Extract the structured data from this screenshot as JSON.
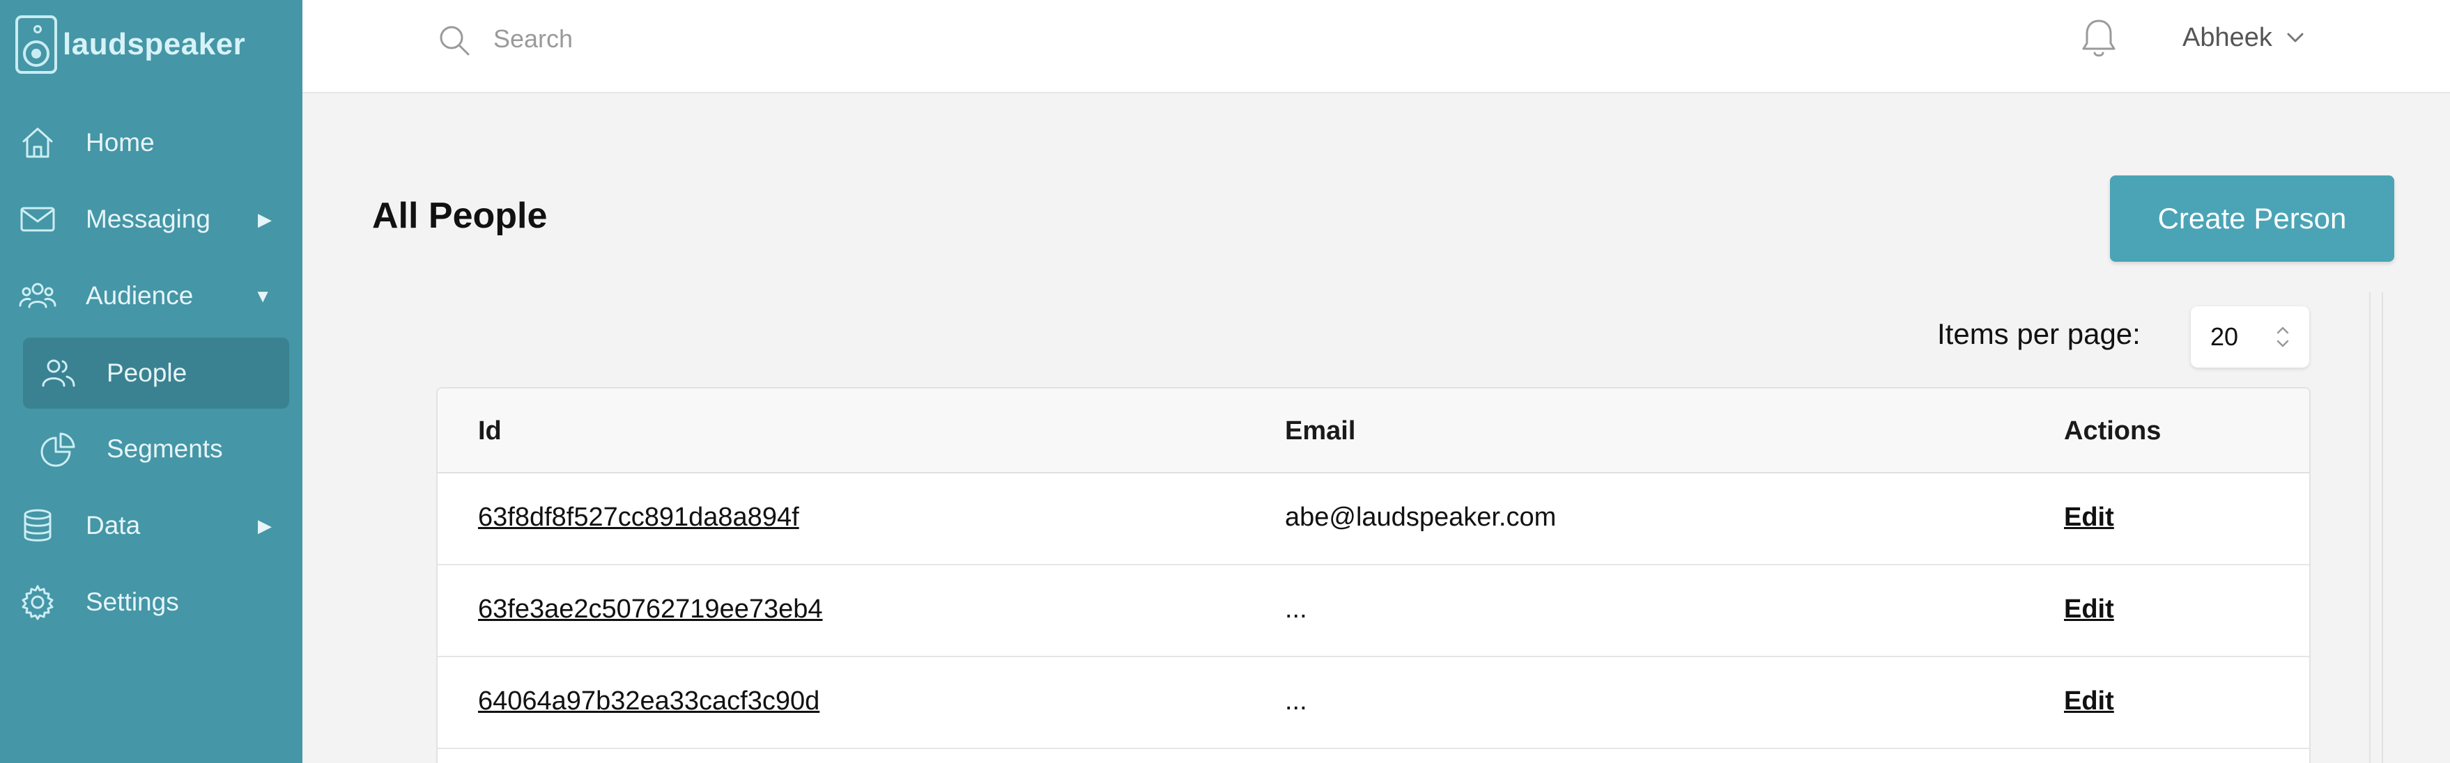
{
  "app": {
    "name": "laudspeaker"
  },
  "sidebar": {
    "items": [
      {
        "label": "Home",
        "icon": "home-icon"
      },
      {
        "label": "Messaging",
        "icon": "envelope-icon",
        "arrow": "▶"
      },
      {
        "label": "Audience",
        "icon": "users-icon",
        "arrow": "▼",
        "children": [
          {
            "label": "People",
            "icon": "people-icon",
            "active": true
          },
          {
            "label": "Segments",
            "icon": "pie-chart-icon"
          }
        ]
      },
      {
        "label": "Data",
        "icon": "database-icon",
        "arrow": "▶"
      },
      {
        "label": "Settings",
        "icon": "gear-icon"
      }
    ]
  },
  "topbar": {
    "search_placeholder": "Search",
    "user_name": "Abheek"
  },
  "main": {
    "title": "All People",
    "create_button": "Create Person",
    "items_per_page_label": "Items per page:",
    "items_per_page_value": "20",
    "table": {
      "columns": [
        "Id",
        "Email",
        "Actions"
      ],
      "rows": [
        {
          "id": "63f8df8f527cc891da8a894f",
          "email": "abe@laudspeaker.com",
          "action": "Edit"
        },
        {
          "id": "63fe3ae2c50762719ee73eb4",
          "email": "...",
          "action": "Edit"
        },
        {
          "id": "64064a97b32ea33cacf3c90d",
          "email": "...",
          "action": "Edit"
        }
      ]
    }
  },
  "colors": {
    "sidebar_bg": "#4596a6",
    "sidebar_active": "#3a8291",
    "primary_button": "#4aa4b6",
    "page_bg": "#f3f3f3"
  }
}
